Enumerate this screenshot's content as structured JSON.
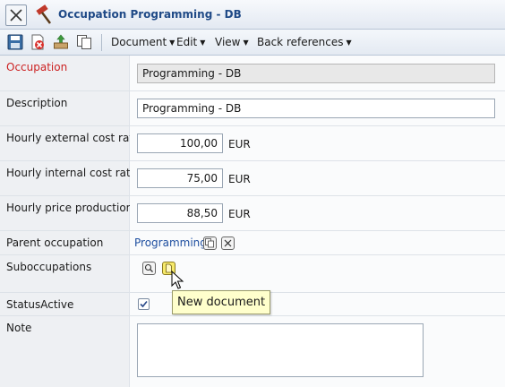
{
  "window": {
    "title": "Occupation Programming - DB"
  },
  "toolbar": {
    "menus": [
      {
        "label": "Document"
      },
      {
        "label": "Edit"
      },
      {
        "label": "View"
      },
      {
        "label": "Back references"
      }
    ]
  },
  "form": {
    "occupation": {
      "label": "Occupation",
      "value": "Programming - DB"
    },
    "description": {
      "label": "Description",
      "value": "Programming - DB"
    },
    "hourly_external": {
      "label": "Hourly external cost rate",
      "value": "100,00",
      "unit": "EUR"
    },
    "hourly_internal": {
      "label": "Hourly internal cost rate",
      "value": "75,00",
      "unit": "EUR"
    },
    "hourly_price": {
      "label": "Hourly price production",
      "value": "88,50",
      "unit": "EUR"
    },
    "parent_occupation": {
      "label": "Parent occupation",
      "value": "Programming"
    },
    "suboccupations": {
      "label": "Suboccupations"
    },
    "status_active": {
      "label": "StatusActive",
      "checked": true
    },
    "note": {
      "label": "Note",
      "value": ""
    }
  },
  "tooltip": {
    "text": "New document"
  },
  "colors": {
    "title": "#204a87",
    "required_label": "#cc2222",
    "link": "#1f4fa0",
    "tooltip_bg": "#ffffcc"
  }
}
